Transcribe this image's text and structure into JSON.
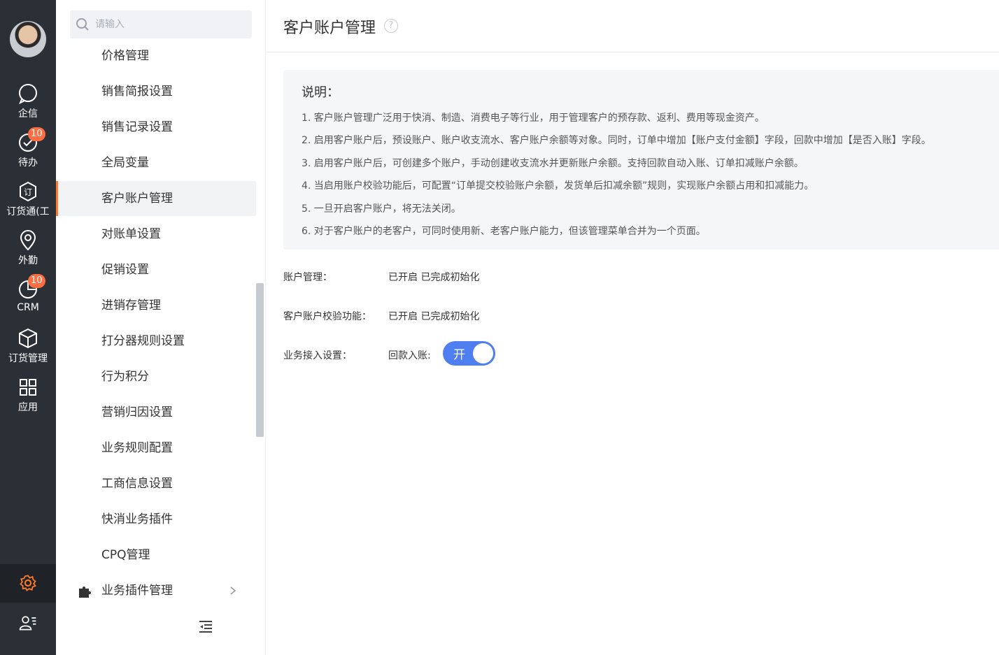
{
  "rail": {
    "items": [
      {
        "label": "企信",
        "icon": "chat-icon"
      },
      {
        "label": "待办",
        "icon": "check-circle-icon",
        "badge": "10"
      },
      {
        "label": "订货通(工",
        "icon": "order-icon"
      },
      {
        "label": "外勤",
        "icon": "location-pin-icon"
      },
      {
        "label": "CRM",
        "icon": "pie-chart-icon",
        "badge": "10"
      },
      {
        "label": "订货管理",
        "icon": "box-icon"
      },
      {
        "label": "应用",
        "icon": "grid-icon"
      }
    ],
    "settings_icon": "gear-icon",
    "profile_icon": "user-list-icon",
    "accent": "#ff7a2b"
  },
  "search": {
    "placeholder": "请输入"
  },
  "menu": {
    "items": [
      "价格管理",
      "销售简报设置",
      "销售记录设置",
      "全局变量",
      "客户账户管理",
      "对账单设置",
      "促销设置",
      "进销存管理",
      "打分器规则设置",
      "行为积分",
      "营销归因设置",
      "业务规则配置",
      "工商信息设置",
      "快消业务插件",
      "CPQ管理",
      "业务插件管理"
    ],
    "active_index": 4
  },
  "page": {
    "title": "客户账户管理",
    "help": "?"
  },
  "note": {
    "title": "说明：",
    "lines": [
      "1. 客户账户管理广泛用于快消、制造、消费电子等行业，用于管理客户的预存款、返利、费用等现金资产。",
      "2. 启用客户账户后，预设账户、账户收支流水、客户账户余额等对象。同时，订单中增加【账户支付金额】字段，回款中增加【是否入账】字段。",
      "3. 启用客户账户后，可创建多个账户，手动创建收支流水并更新账户余额。支持回款自动入账、订单扣减账户余额。",
      "4. 当启用账户校验功能后，可配置“订单提交校验账户余额，发货单后扣减余额”规则，实现账户余额占用和扣减能力。",
      "5. 一旦开启客户账户，将无法关闭。",
      "6. 对于客户账户的老客户，可同时使用新、老客户账户能力，但该管理菜单合并为一个页面。"
    ]
  },
  "settings": {
    "account_mgmt": {
      "label": "账户管理：",
      "value": "已开启  已完成初始化"
    },
    "verify": {
      "label": "客户账户校验功能：",
      "value": "已开启  已完成初始化"
    },
    "business": {
      "label": "业务接入设置：",
      "value": "回款入账:",
      "toggle_label": "开",
      "toggle_color": "#4f7ef0"
    }
  }
}
